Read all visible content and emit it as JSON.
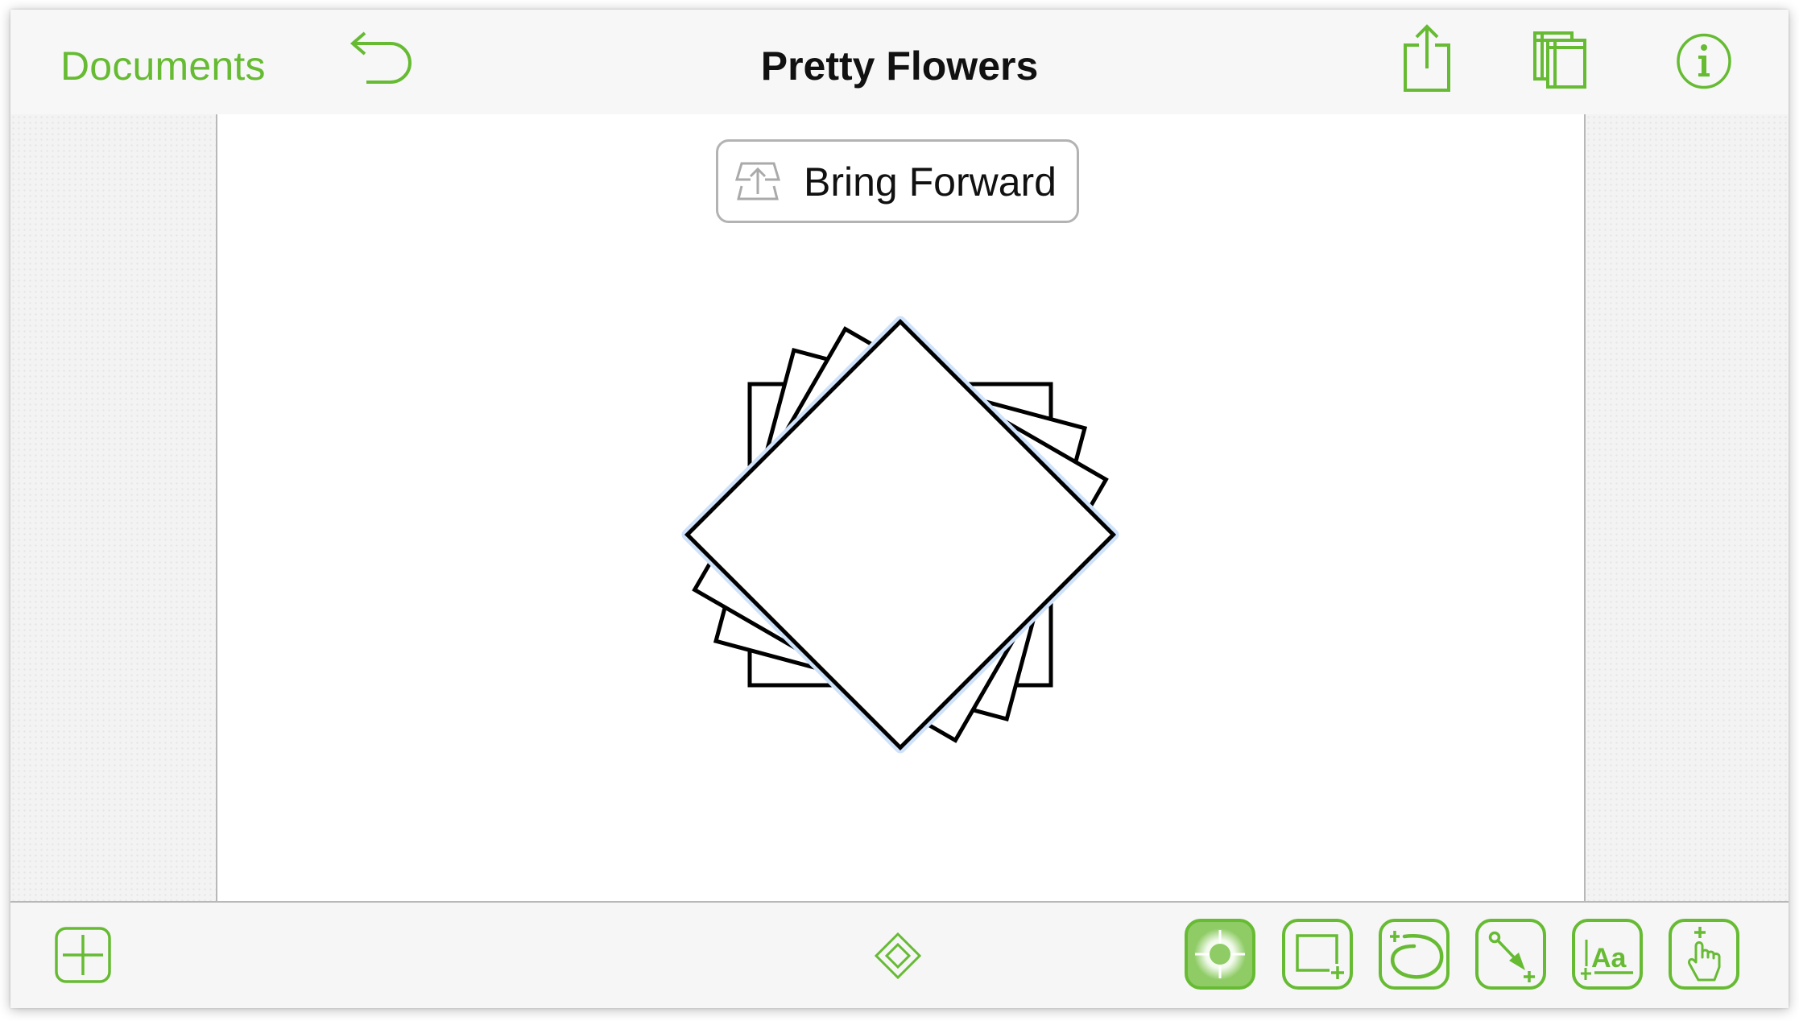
{
  "window": {
    "title": "Pretty Flowers",
    "accent_color": "#66bb33"
  },
  "header": {
    "documents_label": "Documents",
    "icons": {
      "undo": "undo-icon",
      "share": "share-icon",
      "documents_view": "documents-view-icon",
      "inspector": "info-icon"
    }
  },
  "canvas": {
    "context_button": {
      "label": "Bring Forward",
      "icon": "bring-forward-icon"
    },
    "shapes": [
      {
        "type": "square",
        "rotation_deg": 0,
        "selected": false
      },
      {
        "type": "square",
        "rotation_deg": 15,
        "selected": false
      },
      {
        "type": "square",
        "rotation_deg": 30,
        "selected": false
      },
      {
        "type": "square",
        "rotation_deg": 45,
        "selected": true
      }
    ],
    "selection_color": "#cfe2fb"
  },
  "toolbar": {
    "add_icon": "add-canvas-icon",
    "center_icon": "diamond-icon",
    "tools": [
      {
        "name": "selection-tool",
        "icon": "selection-crosshair-icon",
        "active": true
      },
      {
        "name": "shape-tool",
        "icon": "rectangle-plus-icon",
        "active": false
      },
      {
        "name": "freehand-tool",
        "icon": "freehand-loop-icon",
        "active": false
      },
      {
        "name": "line-tool",
        "icon": "line-arrow-icon",
        "active": false
      },
      {
        "name": "text-tool",
        "icon": "text-aa-icon",
        "active": false,
        "label": "Aa"
      },
      {
        "name": "touch-tool",
        "icon": "pointing-hand-icon",
        "active": false
      }
    ]
  }
}
